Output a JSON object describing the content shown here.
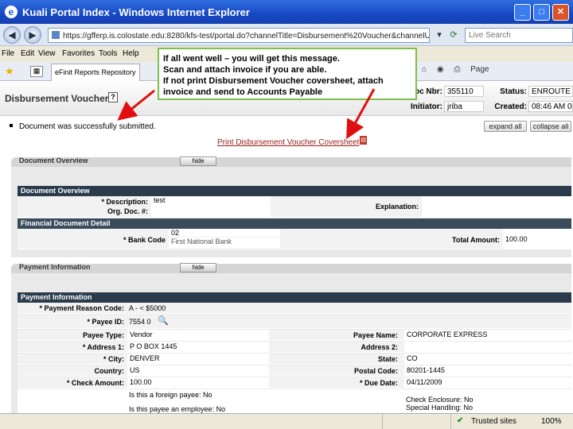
{
  "browser": {
    "title": "Kuali Portal Index - Windows Internet Explorer",
    "url": "https://gfferp.is.colostate.edu:8280/kfs-test/portal.do?channelTitle=Disbursement%20Voucher&channelUrl=financialDisbursem",
    "search_placeholder": "Live Search",
    "menu": [
      "File",
      "Edit",
      "View",
      "Favorites",
      "Tools",
      "Help"
    ],
    "tab_label": "eFinit Reports Repository",
    "toolbar_page": "Page"
  },
  "document": {
    "title": "Disbursement Voucher",
    "doc_nbr_label": "Doc Nbr:",
    "doc_nbr": "355110",
    "status_label": "Status:",
    "status": "ENROUTE",
    "initiator_label": "Initiator:",
    "initiator": "jriba",
    "created_label": "Created:",
    "created": "08:46 AM 04/11",
    "message": "Document was successfully submitted.",
    "expand_all": "expand all",
    "collapse_all": "collapse all",
    "print_link": "Print Disbursement Voucher Coversheet"
  },
  "overview": {
    "tab_title": "Document Overview",
    "hide_label": "hide",
    "section_title": "Document Overview",
    "description_label": "* Description:",
    "description": "test",
    "org_doc_label": "Org. Doc. #:",
    "explanation_label": "Explanation:",
    "fin_detail_title": "Financial Document Detail",
    "bank_code_label": "* Bank Code",
    "bank_code": "02",
    "bank_name": "First National Bank",
    "total_amount_label": "Total Amount:",
    "total_amount": "100.00"
  },
  "payment": {
    "tab_title": "Payment Information",
    "hide_label": "hide",
    "section_title": "Payment Information",
    "reason_label": "* Payment Reason Code:",
    "reason": "A - < $5000",
    "payee_id_label": "* Payee ID:",
    "payee_id": "7554 0",
    "payee_type_label": "Payee Type:",
    "payee_type": "Vendor",
    "payee_name_label": "Payee Name:",
    "payee_name": "CORPORATE EXPRESS",
    "address1_label": "* Address 1:",
    "address1": "P O BOX 1445",
    "address2_label": "Address 2:",
    "address2": "",
    "city_label": "* City:",
    "city": "DENVER",
    "state_label": "State:",
    "state": "CO",
    "country_label": "Country:",
    "country": "US",
    "postal_label": "Postal Code:",
    "postal": "80201-1445",
    "check_amount_label": "* Check Amount:",
    "check_amount": "100.00",
    "due_date_label": "* Due Date:",
    "due_date": "04/11/2009",
    "foreign_payee": "Is this a foreign payee: No",
    "employee": "Is this payee an employee: No",
    "check_enclosure": "Check Enclosure: No",
    "special_handling": "Special Handling: No"
  },
  "callout": {
    "line1": "If all went well – you will get this message.",
    "line2": "Scan and attach invoice if you are able.",
    "line3": "If not print Disbursement Voucher coversheet, attach invoice and send to Accounts Payable"
  },
  "status": {
    "zone": "Trusted sites",
    "zoom": "100%"
  },
  "colors": {
    "callout_border": "#7fbf4d",
    "arrow": "#e01010",
    "section_header": "#2a3b4c"
  }
}
